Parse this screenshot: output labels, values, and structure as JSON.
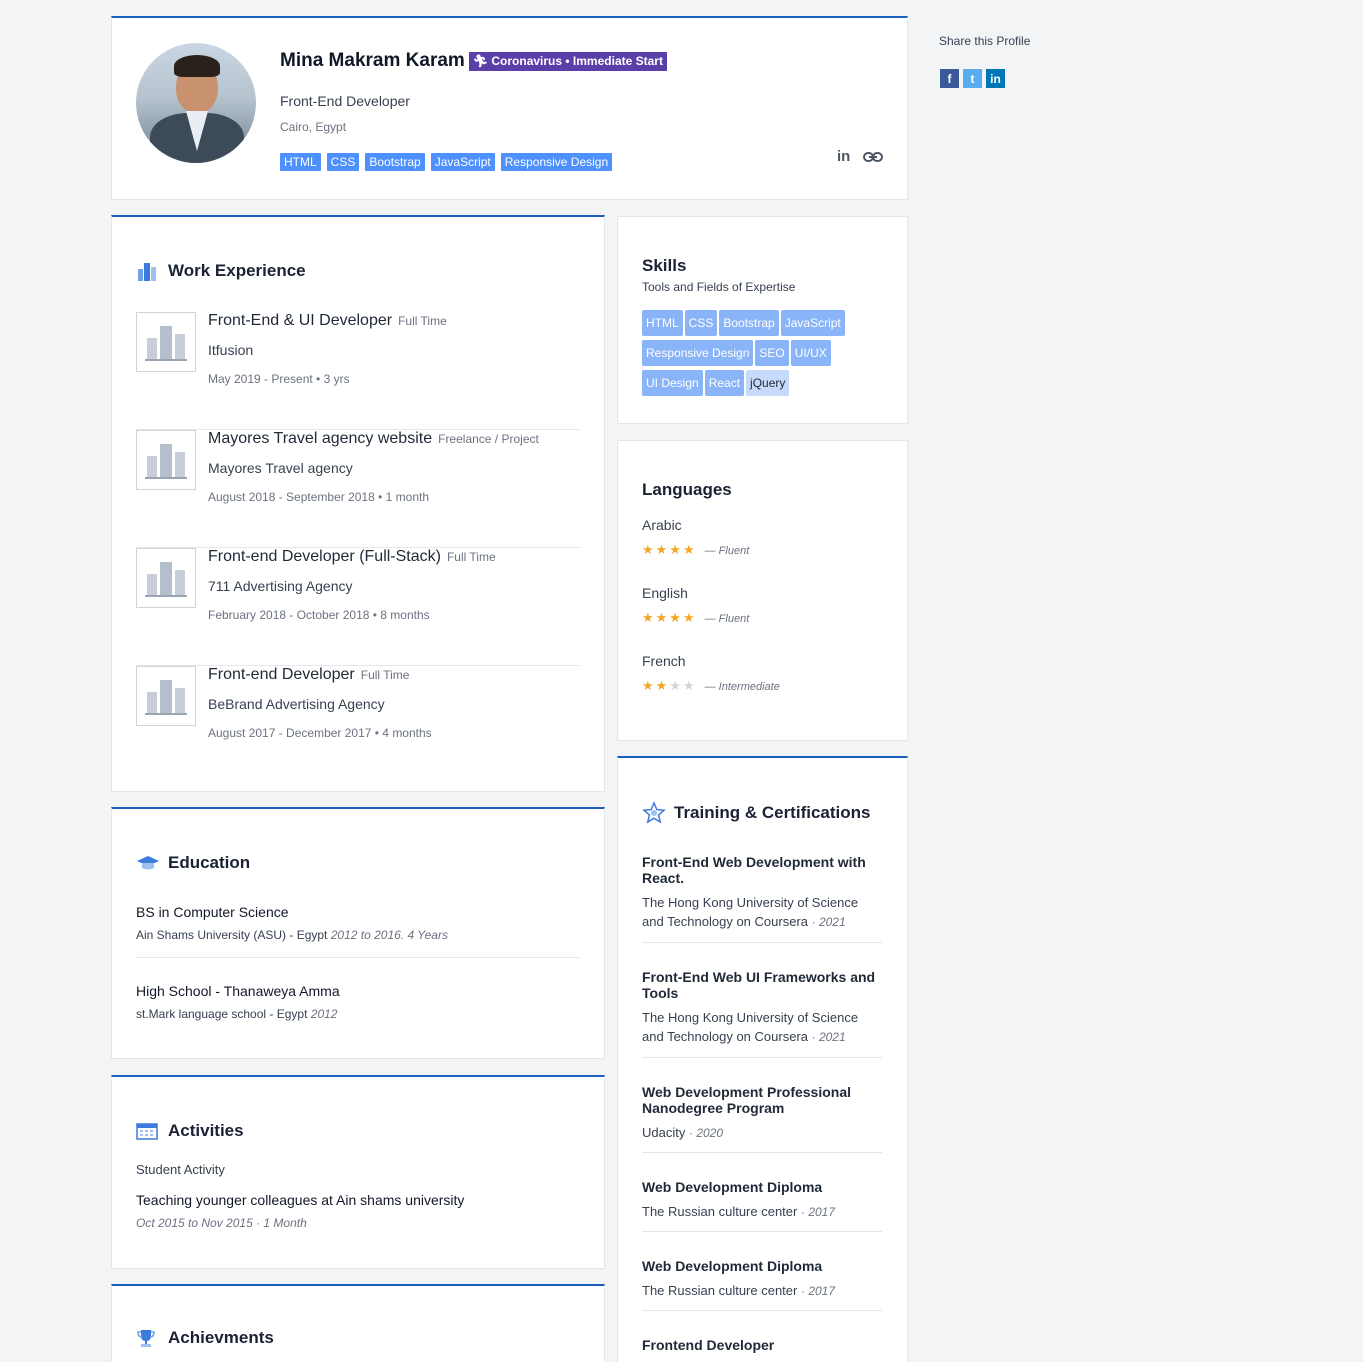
{
  "profile": {
    "name": "Mina Makram Karam",
    "badge": "Coronavirus • Immediate Start",
    "title": "Front-End Developer",
    "location": "Cairo, Egypt",
    "tags": [
      "HTML",
      "CSS",
      "Bootstrap",
      "JavaScript",
      "Responsive Design"
    ]
  },
  "share": {
    "label": "Share this Profile"
  },
  "work": {
    "title": "Work Experience",
    "items": [
      {
        "title": "Front-End & UI Developer",
        "type": "Full Time",
        "company": "Itfusion",
        "date": "May 2019 - Present • 3 yrs"
      },
      {
        "title": "Mayores Travel agency website",
        "type": "Freelance / Project",
        "company": "Mayores Travel agency",
        "date": "August 2018 - September 2018 • 1 month"
      },
      {
        "title": "Front-end Developer (Full-Stack)",
        "type": "Full Time",
        "company": "711 Advertising Agency",
        "date": "February 2018 - October 2018 • 8 months"
      },
      {
        "title": "Front-end Developer",
        "type": "Full Time",
        "company": "BeBrand Advertising Agency",
        "date": "August 2017 - December 2017 • 4 months"
      }
    ]
  },
  "skills": {
    "title": "Skills",
    "subtitle": "Tools and Fields of Expertise",
    "items": [
      "HTML",
      "CSS",
      "Bootstrap",
      "JavaScript",
      "Responsive Design",
      "SEO",
      "UI/UX",
      "UI Design",
      "React",
      "jQuery"
    ]
  },
  "languages": {
    "title": "Languages",
    "items": [
      {
        "name": "Arabic",
        "stars": 4,
        "level": "— Fluent"
      },
      {
        "name": "English",
        "stars": 4,
        "level": "— Fluent"
      },
      {
        "name": "French",
        "stars": 2,
        "level": "— Intermediate"
      }
    ]
  },
  "education": {
    "title": "Education",
    "items": [
      {
        "degree": "BS in Computer Science",
        "school": "Ain Shams University (ASU) - Egypt",
        "date": "2012 to 2016. 4 Years"
      },
      {
        "degree": "High School - Thanaweya Amma",
        "school": "st.Mark language school - Egypt",
        "date": "2012"
      }
    ]
  },
  "activities": {
    "title": "Activities",
    "category": "Student Activity",
    "item_title": "Teaching younger colleagues at Ain shams university",
    "item_date": "Oct 2015 to Nov 2015 · 1 Month"
  },
  "achievements": {
    "title": "Achievments"
  },
  "training": {
    "title": "Training & Certifications",
    "items": [
      {
        "title": "Front-End Web Development with React.",
        "source": "The Hong Kong University of Science and Technology on Coursera",
        "year": "· 2021"
      },
      {
        "title": "Front-End Web UI Frameworks and Tools",
        "source": "The Hong Kong University of Science and Technology on Coursera",
        "year": "· 2021"
      },
      {
        "title": "Web Development Professional Nanodegree Program",
        "source": "Udacity",
        "year": "· 2020"
      },
      {
        "title": "Web Development Diploma",
        "source": "The Russian culture center",
        "year": "· 2017"
      },
      {
        "title": "Web Development Diploma",
        "source": "The Russian culture center",
        "year": "· 2017"
      },
      {
        "title": "Frontend Developer",
        "source": "",
        "year": ""
      }
    ]
  },
  "colors": {
    "accent": "#1d5fbf",
    "tag": "#4d90fe",
    "badge": "#5b3fa8",
    "star": "#f5a623"
  }
}
